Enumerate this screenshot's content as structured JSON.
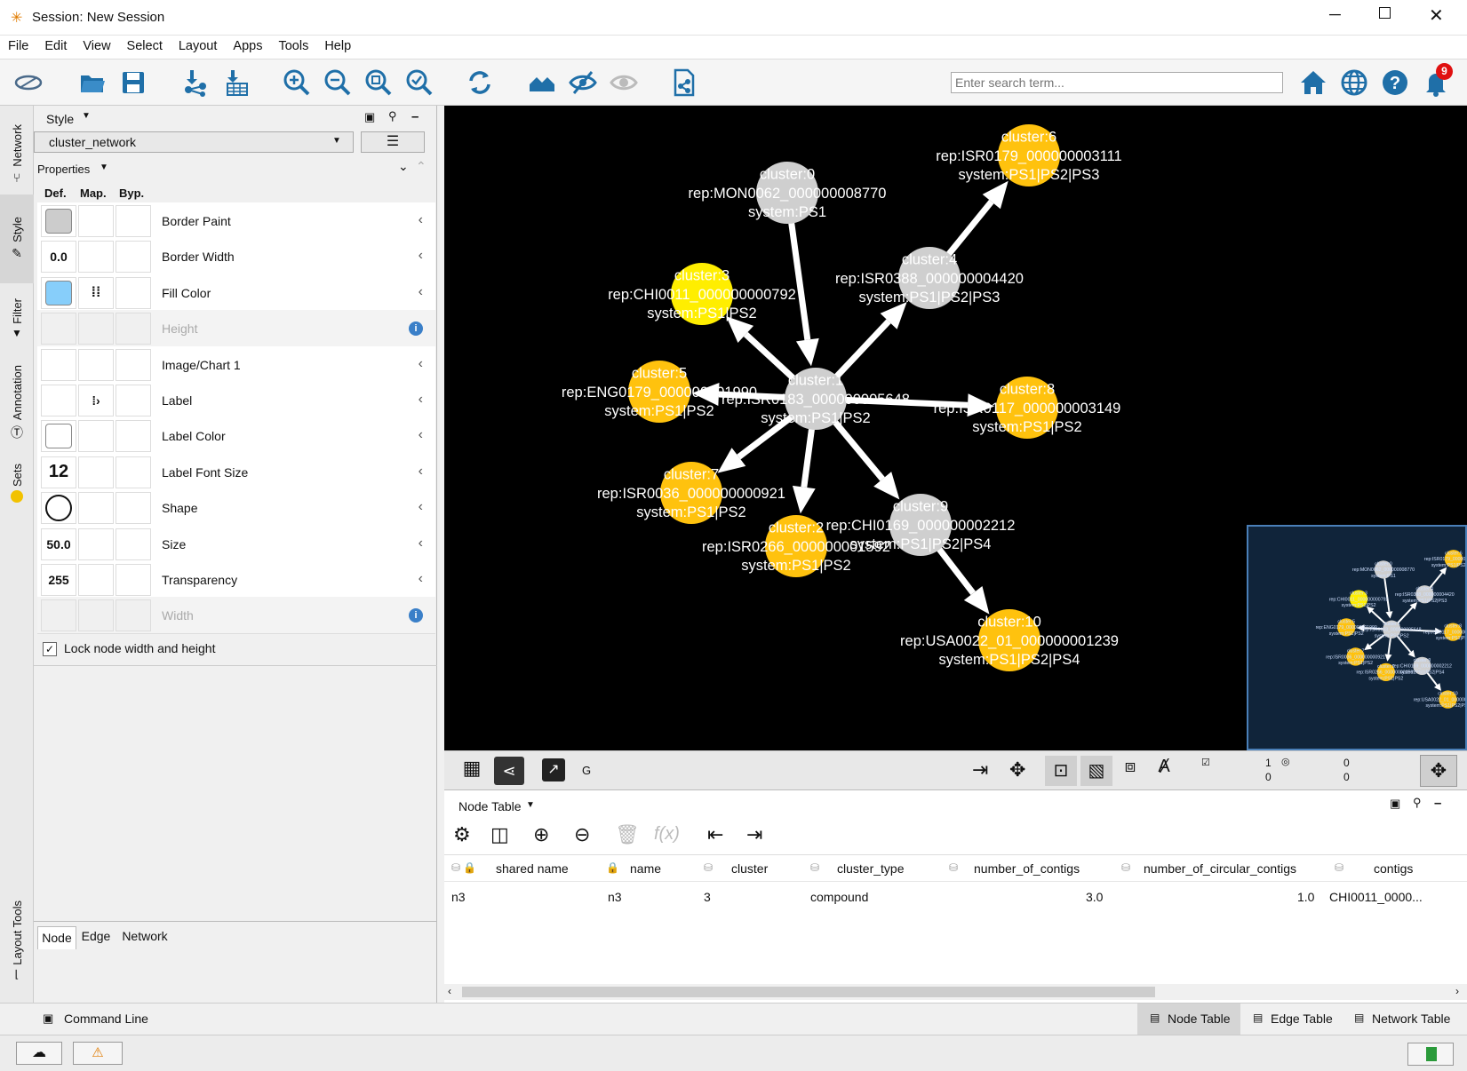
{
  "window": {
    "title": "Session: New Session"
  },
  "menu": [
    "File",
    "Edit",
    "View",
    "Select",
    "Layout",
    "Apps",
    "Tools",
    "Help"
  ],
  "toolbar": {
    "search_placeholder": "Enter search term...",
    "notification_count": "9"
  },
  "side_tabs": [
    "Network",
    "Style",
    "Filter",
    "Annotation",
    "Sets",
    "Layout Tools"
  ],
  "style_panel": {
    "header": "Style",
    "style_select": "cluster_network",
    "properties_label": "Properties",
    "col_def": "Def.",
    "col_map": "Map.",
    "col_byp": "Byp.",
    "rows": [
      {
        "label": "Border Paint",
        "def": ""
      },
      {
        "label": "Border Width",
        "def": "0.0"
      },
      {
        "label": "Fill Color",
        "def": ""
      },
      {
        "label": "Height",
        "def": ""
      },
      {
        "label": "Image/Chart 1",
        "def": ""
      },
      {
        "label": "Label",
        "def": ""
      },
      {
        "label": "Label Color",
        "def": ""
      },
      {
        "label": "Label Font Size",
        "def": "12"
      },
      {
        "label": "Shape",
        "def": ""
      },
      {
        "label": "Size",
        "def": "50.0"
      },
      {
        "label": "Transparency",
        "def": "255"
      },
      {
        "label": "Width",
        "def": ""
      }
    ],
    "lock_label": "Lock node width and height",
    "bottom_tabs": [
      "Node",
      "Edge",
      "Network"
    ]
  },
  "network": {
    "nodes": [
      {
        "id": "c0",
        "l1": "cluster:0",
        "l2": "rep:MON0062_000000008770",
        "l3": "system:PS1",
        "color": "#cfcfcf"
      },
      {
        "id": "c6",
        "l1": "cluster:6",
        "l2": "rep:ISR0179_000000003111",
        "l3": "system:PS1|PS2|PS3",
        "color": "#ffc20e"
      },
      {
        "id": "c4",
        "l1": "cluster:4",
        "l2": "rep:ISR0388_000000004420",
        "l3": "system:PS1|PS2|PS3",
        "color": "#cfcfcf"
      },
      {
        "id": "c3",
        "l1": "cluster:3",
        "l2": "rep:CHI0011_000000000792",
        "l3": "system:PS1|PS2",
        "color": "#ffee00"
      },
      {
        "id": "c5",
        "l1": "cluster:5",
        "l2": "rep:ENG0179_000000001990",
        "l3": "system:PS1|PS2",
        "color": "#ffc20e"
      },
      {
        "id": "c1",
        "l1": "cluster:1",
        "l2": "rep:ISR0183_000000005648",
        "l3": "system:PS1|PS2",
        "color": "#cfcfcf"
      },
      {
        "id": "c8",
        "l1": "cluster:8",
        "l2": "rep:ISR0117_000000003149",
        "l3": "system:PS1|PS2",
        "color": "#ffc20e"
      },
      {
        "id": "c7",
        "l1": "cluster:7",
        "l2": "rep:ISR0036_000000000921",
        "l3": "system:PS1|PS2",
        "color": "#ffc20e"
      },
      {
        "id": "c9",
        "l1": "cluster:9",
        "l2": "rep:CHI0169_000000002212",
        "l3": "system:PS1|PS2|PS4",
        "color": "#cfcfcf"
      },
      {
        "id": "c2",
        "l1": "cluster:2",
        "l2": "rep:ISR0266_000000001592",
        "l3": "system:PS1|PS2",
        "color": "#ffc20e"
      },
      {
        "id": "c10",
        "l1": "cluster:10",
        "l2": "rep:USA0022_01_000000001239",
        "l3": "system:PS1|PS2|PS4",
        "color": "#ffc20e"
      }
    ],
    "edges": [
      [
        "c0",
        "c1"
      ],
      [
        "c1",
        "c3"
      ],
      [
        "c1",
        "c4"
      ],
      [
        "c4",
        "c6"
      ],
      [
        "c1",
        "c5"
      ],
      [
        "c1",
        "c8"
      ],
      [
        "c1",
        "c7"
      ],
      [
        "c1",
        "c2"
      ],
      [
        "c1",
        "c9"
      ],
      [
        "c9",
        "c10"
      ]
    ]
  },
  "canvas_bar": {
    "text": "G",
    "selected_nodes": "1",
    "hidden_nodes": "0",
    "selected_edges": "0",
    "hidden_edges": "0"
  },
  "table": {
    "title": "Node Table",
    "columns": [
      "shared name",
      "name",
      "cluster",
      "cluster_type",
      "number_of_contigs",
      "number_of_circular_contigs",
      "contigs"
    ],
    "rows": [
      [
        "n3",
        "n3",
        "3",
        "compound",
        "3.0",
        "1.0",
        "CHI0011_0000..."
      ]
    ]
  },
  "bottom_tabs": {
    "command_line": "Command Line",
    "node_table": "Node Table",
    "edge_table": "Edge Table",
    "network_table": "Network Table"
  }
}
